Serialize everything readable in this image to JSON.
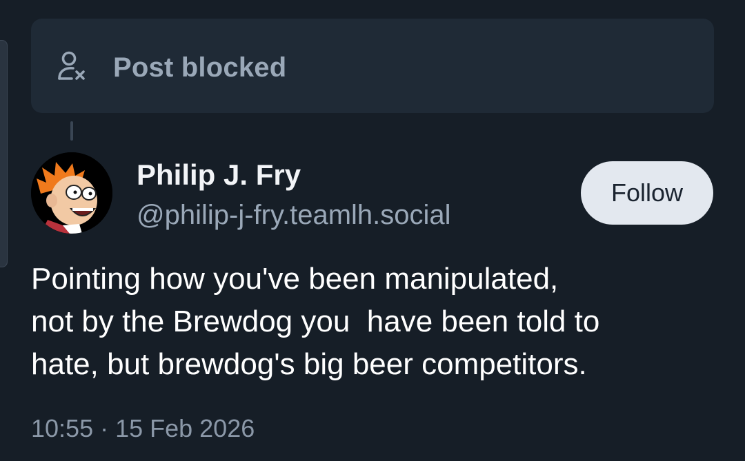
{
  "blocked": {
    "label": "Post blocked",
    "icon": "person-blocked-icon"
  },
  "author": {
    "name": "Philip J. Fry",
    "handle": "@philip-j-fry.teamlh.social",
    "avatar": "avatar-cartoon-character"
  },
  "follow_button": {
    "label": "Follow"
  },
  "post": {
    "text": "Pointing how you've been manipulated,\nnot by the Brewdog you  have been told to\nhate, but brewdog's big beer competitors.",
    "timestamp": "10:55 · 15 Feb 2026"
  },
  "colors": {
    "background": "#161e27",
    "card": "#1f2a36",
    "muted_text": "#9aa8b8",
    "button_bg": "#e3e8ef"
  }
}
